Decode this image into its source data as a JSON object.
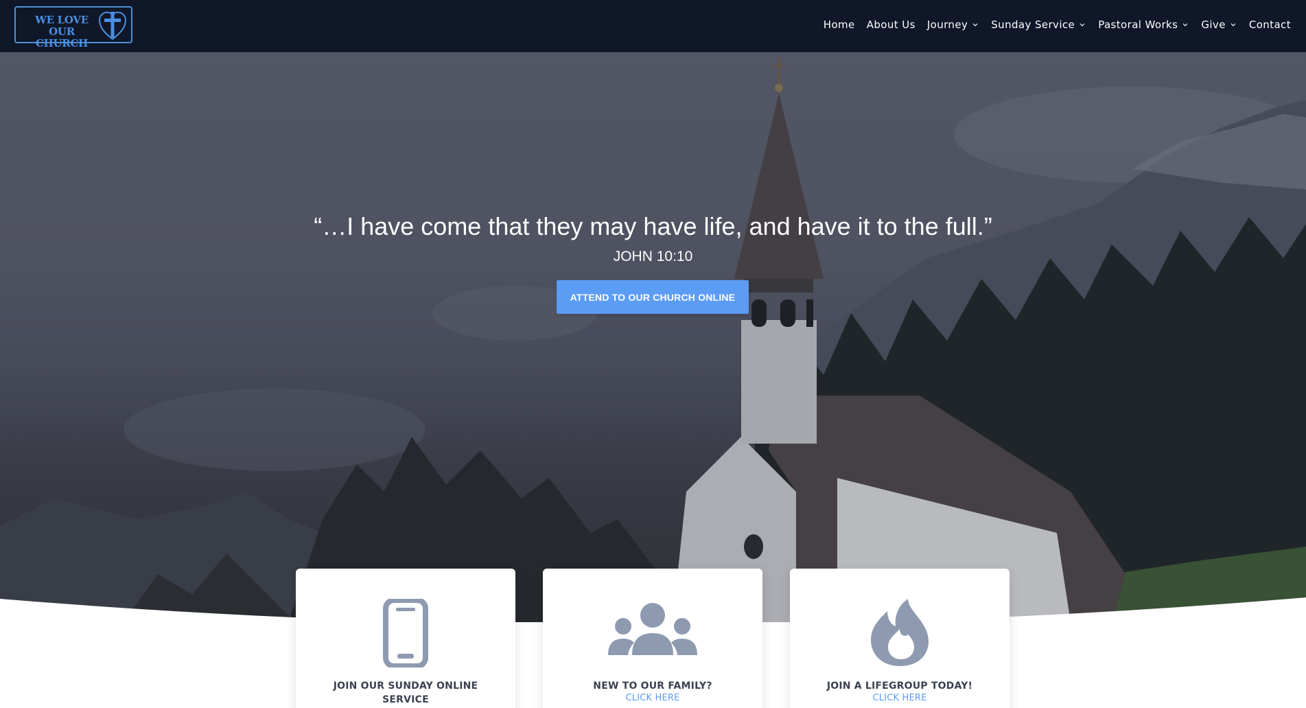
{
  "brand": {
    "logo_line1": "WE LOVE OUR",
    "logo_line2": "CHURCH"
  },
  "nav": {
    "items": [
      {
        "label": "Home",
        "has_dropdown": false
      },
      {
        "label": "About Us",
        "has_dropdown": false
      },
      {
        "label": "Journey",
        "has_dropdown": true
      },
      {
        "label": "Sunday Service",
        "has_dropdown": true
      },
      {
        "label": "Pastoral Works",
        "has_dropdown": true
      },
      {
        "label": "Give",
        "has_dropdown": true
      },
      {
        "label": "Contact",
        "has_dropdown": false
      }
    ]
  },
  "hero": {
    "quote": "“…I have come that they may have life, and have it to the full.”",
    "reference": "JOHN 10:10",
    "cta_label": "ATTEND TO OUR CHURCH ONLINE"
  },
  "cards": [
    {
      "icon": "mobile-phone-icon",
      "title": "JOIN OUR SUNDAY ONLINE SERVICE",
      "link": ""
    },
    {
      "icon": "people-group-icon",
      "title": "NEW TO OUR FAMILY?",
      "link": "CLICK HERE"
    },
    {
      "icon": "fire-icon",
      "title": "JOIN A LIFEGROUP TODAY!",
      "link": "CLICK HERE"
    }
  ],
  "colors": {
    "header_bg": "#0f1729",
    "accent": "#5b9cf5",
    "logo_blue": "#4a90e2",
    "icon_gray": "#8e9ab0",
    "card_title": "#3b4150"
  }
}
